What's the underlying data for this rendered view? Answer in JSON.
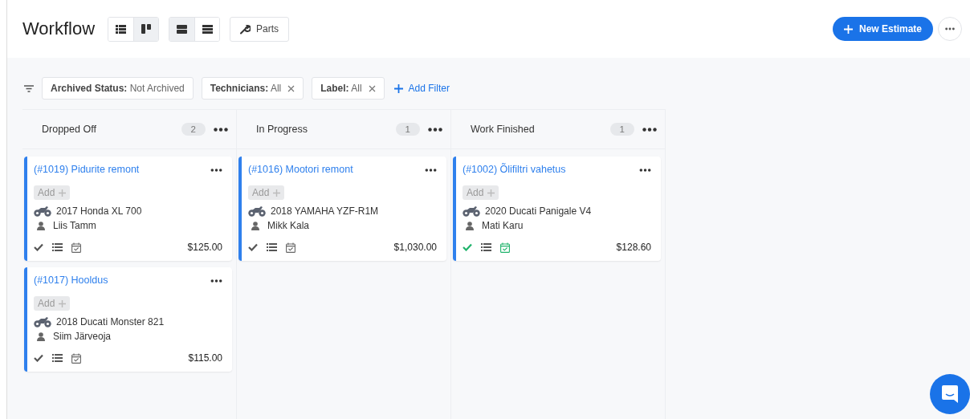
{
  "header": {
    "title": "Workflow",
    "layout_toggles": [
      {
        "kind": "list",
        "selected": false
      },
      {
        "kind": "board",
        "selected": true
      }
    ],
    "density_toggles": [
      {
        "kind": "comfortable",
        "selected": true
      },
      {
        "kind": "compact",
        "selected": false
      }
    ],
    "parts_button": "Parts",
    "new_button": "New Estimate"
  },
  "filters": [
    {
      "name": "Archived Status:",
      "value": "Not Archived",
      "removable": false
    },
    {
      "name": "Technicians:",
      "value": "All",
      "removable": true
    },
    {
      "name": "Label:",
      "value": "All",
      "removable": true
    }
  ],
  "add_filter": "Add Filter",
  "columns": [
    {
      "title": "Dropped Off",
      "count": "2",
      "cards": [
        {
          "title": "(#1019) Pidurite remont",
          "tag_button": "Add",
          "vehicle": "2017 Honda XL 700",
          "customer": "Liis Tamm",
          "total": "$125.00",
          "completed": false
        },
        {
          "title": "(#1017) Hooldus",
          "tag_button": "Add",
          "vehicle": "2018 Ducati Monster 821",
          "customer": "Siim Järveoja",
          "total": "$115.00",
          "completed": false
        }
      ]
    },
    {
      "title": "In Progress",
      "count": "1",
      "cards": [
        {
          "title": "(#1016) Mootori remont",
          "tag_button": "Add",
          "vehicle": "2018 YAMAHA YZF-R1M",
          "customer": "Mikk Kala",
          "total": "$1,030.00",
          "completed": false
        }
      ]
    },
    {
      "title": "Work Finished",
      "count": "1",
      "cards": [
        {
          "title": "(#1002) Õlifiltri vahetus",
          "tag_button": "Add",
          "vehicle": "2020 Ducati Panigale V4",
          "customer": "Mati Karu",
          "total": "$128.60",
          "completed": true
        }
      ]
    }
  ]
}
